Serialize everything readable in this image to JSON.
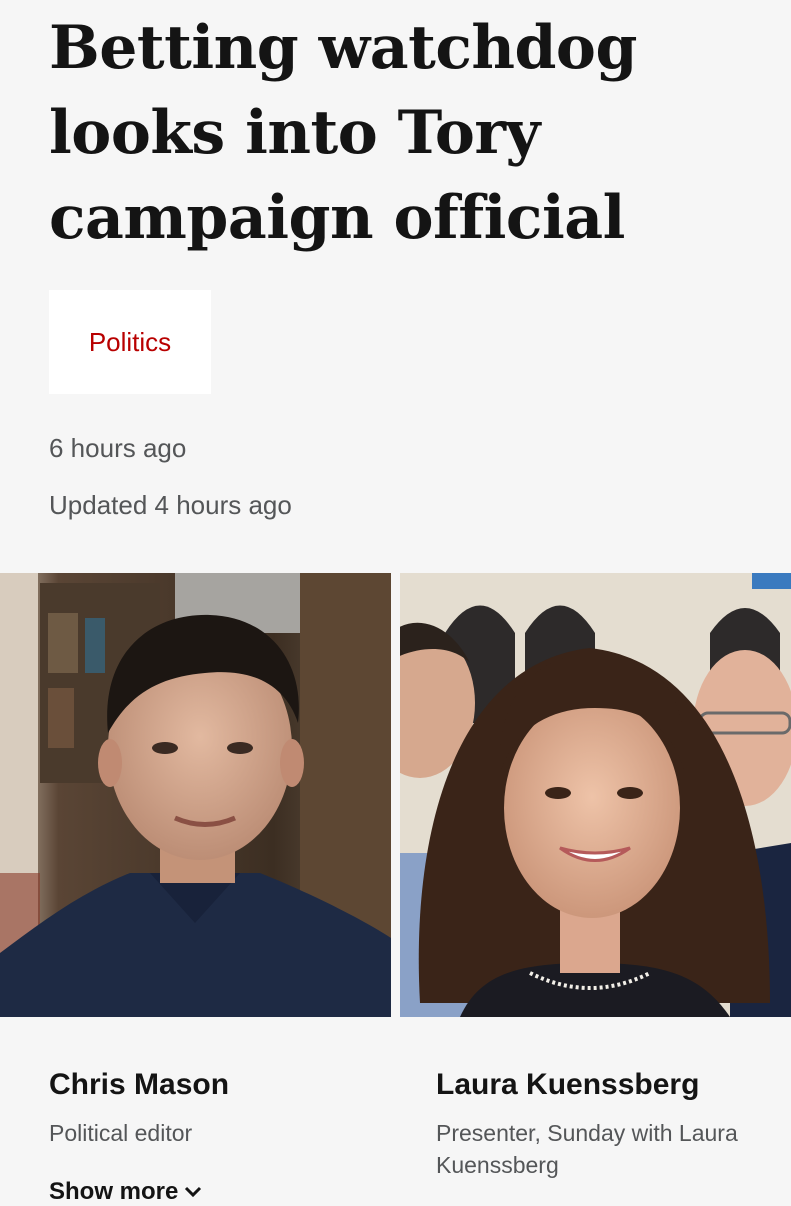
{
  "article": {
    "headline": "Betting watchdog looks into Tory campaign official",
    "topic": "Politics",
    "published": "6 hours ago",
    "updated": "Updated 4 hours ago"
  },
  "authors": [
    {
      "name": "Chris Mason",
      "role": "Political editor"
    },
    {
      "name": "Laura Kuenssberg",
      "role": "Presenter, Sunday with Laura Kuenssberg"
    }
  ],
  "show_more_label": "Show more",
  "icons": {
    "show_more": "chevron-down-icon"
  },
  "colors": {
    "topic_red": "#b80000",
    "background": "#f6f6f6",
    "muted_text": "#545658"
  }
}
